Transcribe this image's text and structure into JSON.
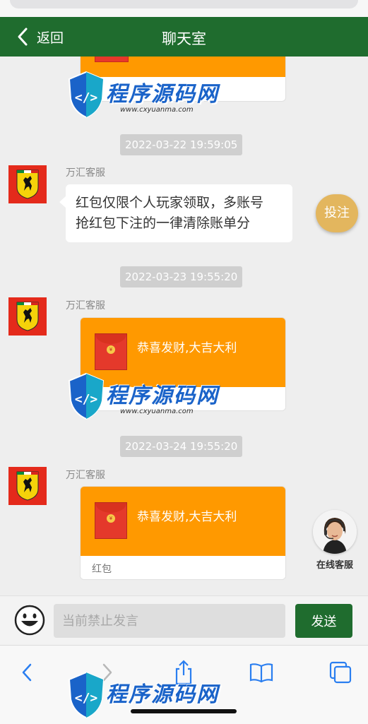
{
  "header": {
    "back_label": "返回",
    "title": "聊天室",
    "accent_color": "#1f6c2e"
  },
  "messages": [
    {
      "type": "timestamp",
      "text": "2022-03-22 19:59:05"
    },
    {
      "type": "text",
      "sender": "万汇客服",
      "text_line1": "红包仅限个人玩家领取，多账号",
      "text_line2": "抢红包下注的一律清除账单分"
    },
    {
      "type": "timestamp",
      "text": "2022-03-23 19:55:20"
    },
    {
      "type": "red_packet",
      "sender": "万汇客服",
      "wish": "恭喜发财,大吉大利",
      "footer": ""
    },
    {
      "type": "timestamp",
      "text": "2022-03-24 19:55:20"
    },
    {
      "type": "red_packet",
      "sender": "万汇客服",
      "wish": "恭喜发财,大吉大利",
      "footer": "红包"
    }
  ],
  "floating": {
    "bet_label": "投注",
    "agent_label": "在线客服"
  },
  "input_bar": {
    "placeholder": "当前禁止发言",
    "send_label": "发送"
  },
  "watermark": {
    "title": "程序源码网",
    "url": "www.cxyuanma.com"
  },
  "icons": [
    "chevron-left-icon",
    "emoji-icon",
    "back-arrow-icon",
    "forward-arrow-icon",
    "share-icon",
    "bookmarks-icon",
    "tabs-icon",
    "coin-icon",
    "ferrari-logo-icon"
  ]
}
